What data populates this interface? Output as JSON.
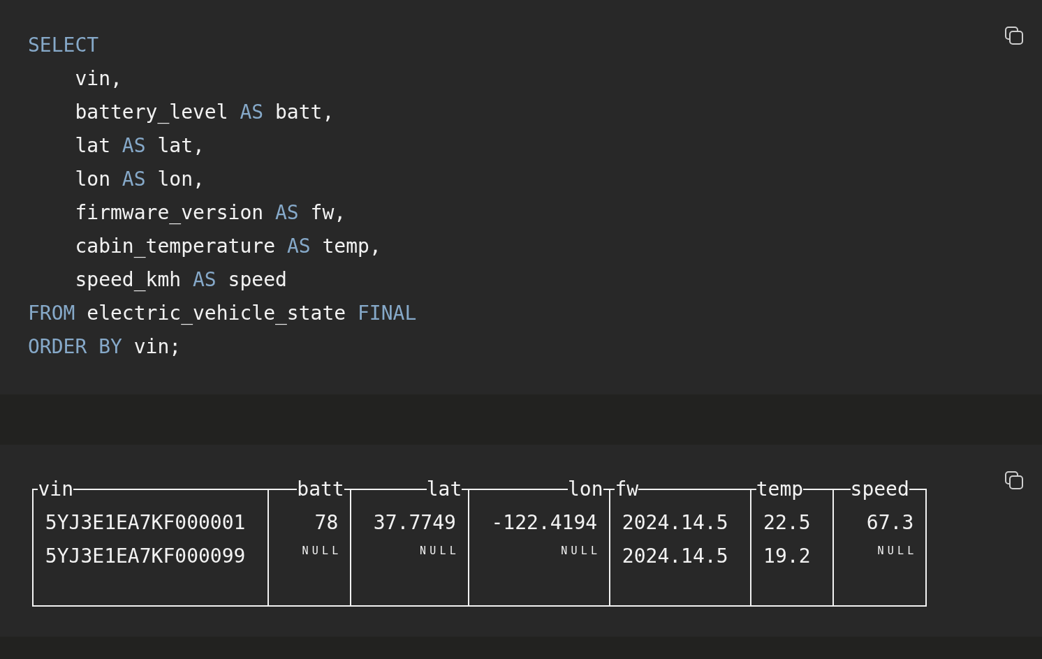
{
  "query_block": {
    "lines": [
      [
        {
          "text": "SELECT",
          "kind": "keyword"
        }
      ],
      [
        {
          "text": "    vin,",
          "kind": "plain"
        }
      ],
      [
        {
          "text": "    battery_level ",
          "kind": "plain"
        },
        {
          "text": "AS",
          "kind": "keyword"
        },
        {
          "text": " batt,",
          "kind": "plain"
        }
      ],
      [
        {
          "text": "    lat ",
          "kind": "plain"
        },
        {
          "text": "AS",
          "kind": "keyword"
        },
        {
          "text": " lat,",
          "kind": "plain"
        }
      ],
      [
        {
          "text": "    lon ",
          "kind": "plain"
        },
        {
          "text": "AS",
          "kind": "keyword"
        },
        {
          "text": " lon,",
          "kind": "plain"
        }
      ],
      [
        {
          "text": "    firmware_version ",
          "kind": "plain"
        },
        {
          "text": "AS",
          "kind": "keyword"
        },
        {
          "text": " fw,",
          "kind": "plain"
        }
      ],
      [
        {
          "text": "    cabin_temperature ",
          "kind": "plain"
        },
        {
          "text": "AS",
          "kind": "keyword"
        },
        {
          "text": " temp,",
          "kind": "plain"
        }
      ],
      [
        {
          "text": "    speed_kmh ",
          "kind": "plain"
        },
        {
          "text": "AS",
          "kind": "keyword"
        },
        {
          "text": " speed",
          "kind": "plain"
        }
      ],
      [
        {
          "text": "FROM",
          "kind": "keyword"
        },
        {
          "text": " electric_vehicle_state ",
          "kind": "plain"
        },
        {
          "text": "FINAL",
          "kind": "keyword"
        }
      ],
      [
        {
          "text": "ORDER BY",
          "kind": "keyword"
        },
        {
          "text": " vin;",
          "kind": "plain"
        }
      ]
    ]
  },
  "result_block": {
    "columns": [
      {
        "label": "vin",
        "kind": "text"
      },
      {
        "label": "batt",
        "kind": "number"
      },
      {
        "label": "lat",
        "kind": "number"
      },
      {
        "label": "lon",
        "kind": "number"
      },
      {
        "label": "fw",
        "kind": "text"
      },
      {
        "label": "temp",
        "kind": "text"
      },
      {
        "label": "speed",
        "kind": "center"
      }
    ],
    "rows": [
      [
        {
          "text": "5YJ3E1EA7KF000001",
          "null": false
        },
        {
          "text": "78",
          "null": false
        },
        {
          "text": "37.7749",
          "null": false
        },
        {
          "text": "-122.4194",
          "null": false
        },
        {
          "text": "2024.14.5",
          "null": false
        },
        {
          "text": "22.5",
          "null": false
        },
        {
          "text": "67.3",
          "null": false
        }
      ],
      [
        {
          "text": "5YJ3E1EA7KF000099",
          "null": false
        },
        {
          "text": "NULL",
          "null": true
        },
        {
          "text": "NULL",
          "null": true
        },
        {
          "text": "NULL",
          "null": true
        },
        {
          "text": "2024.14.5",
          "null": false
        },
        {
          "text": "19.2",
          "null": false
        },
        {
          "text": "NULL",
          "null": true
        }
      ]
    ]
  }
}
